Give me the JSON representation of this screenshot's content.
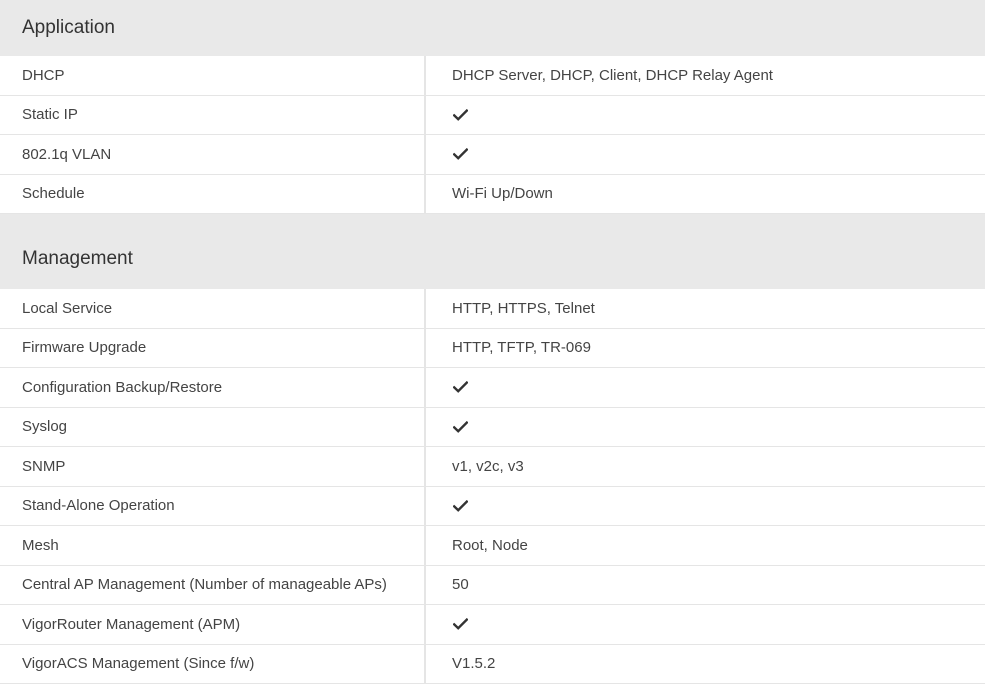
{
  "sections": [
    {
      "title": "Application",
      "rows": [
        {
          "label": "DHCP",
          "value": "DHCP Server, DHCP, Client, DHCP Relay Agent"
        },
        {
          "label": "Static IP",
          "check": true
        },
        {
          "label": "802.1q VLAN",
          "check": true
        },
        {
          "label": "Schedule",
          "value": "Wi-Fi Up/Down"
        }
      ]
    },
    {
      "title": "Management",
      "rows": [
        {
          "label": "Local Service",
          "value": "HTTP, HTTPS, Telnet"
        },
        {
          "label": "Firmware Upgrade",
          "value": "HTTP, TFTP, TR-069"
        },
        {
          "label": "Configuration Backup/Restore",
          "check": true
        },
        {
          "label": "Syslog",
          "check": true
        },
        {
          "label": "SNMP",
          "value": "v1, v2c, v3"
        },
        {
          "label": "Stand-Alone Operation",
          "check": true
        },
        {
          "label": "Mesh",
          "value": "Root, Node"
        },
        {
          "label": "Central AP Management (Number of manageable APs)",
          "value": "50"
        },
        {
          "label": "VigorRouter Management (APM)",
          "check": true
        },
        {
          "label": "VigorACS Management (Since f/w)",
          "value": "V1.5.2"
        }
      ]
    }
  ],
  "icons": {
    "check": "check-icon"
  },
  "colors": {
    "section_header_bg": "#e9e9e9",
    "row_divider": "#e5e5e5",
    "text": "#444444"
  }
}
